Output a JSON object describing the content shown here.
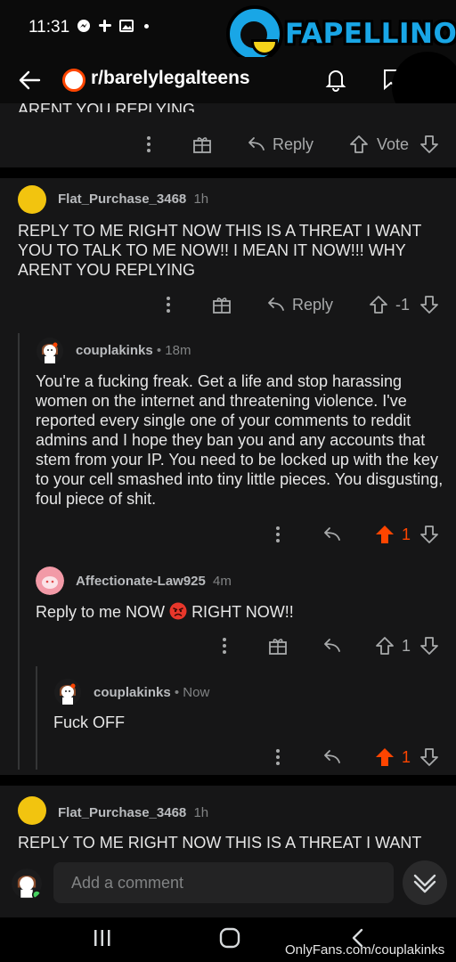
{
  "status": {
    "time": "11:31"
  },
  "watermark": {
    "text": "FAPELLINO",
    "bottom_text": "OnlyFans.com/couplakinks"
  },
  "header": {
    "subreddit": "r/barelylegalteens"
  },
  "prev_comment": {
    "partial_text": "ARENT YOU REPLYING",
    "reply_label": "Reply",
    "vote_label": "Vote"
  },
  "comments": [
    {
      "author": "Flat_Purchase_3468",
      "age": "1h",
      "body": "REPLY TO ME RIGHT NOW THIS IS A THREAT I WANT YOU TO TALK TO ME NOW!! I MEAN IT NOW!!! WHY ARENT YOU REPLYING",
      "reply_label": "Reply",
      "score": "-1"
    },
    {
      "author": "couplakinks",
      "age": "18m",
      "body": "You're a fucking freak. Get a life and stop harassing women on the internet and threatening violence. I've reported every single one of your comments to reddit admins and I hope they ban you and any accounts that stem from your IP. You need to be locked up with the key to your cell smashed into tiny little pieces. You disgusting, foul piece of shit.",
      "score": "1"
    },
    {
      "author": "Affectionate-Law925",
      "age": "4m",
      "body_before": "Reply to me NOW",
      "emoji": "angry-face",
      "body_after": "RIGHT NOW!!",
      "score": "1"
    },
    {
      "author": "couplakinks",
      "age": "Now",
      "body": "Fuck OFF",
      "score": "1"
    },
    {
      "author": "Flat_Purchase_3468",
      "age": "1h",
      "body": "REPLY TO ME RIGHT NOW THIS IS A THREAT I WANT"
    }
  ],
  "meta_separator": " • ",
  "comment_bar": {
    "placeholder": "Add a comment"
  },
  "colors": {
    "upvote_active": "#ff4500",
    "background": "#161617",
    "separator": "#000000"
  },
  "icons": [
    "back-arrow-icon",
    "bell-icon",
    "more-vertical-icon",
    "award-icon",
    "reply-arrow-icon",
    "upvote-icon",
    "downvote-icon",
    "chevron-down-icon"
  ]
}
